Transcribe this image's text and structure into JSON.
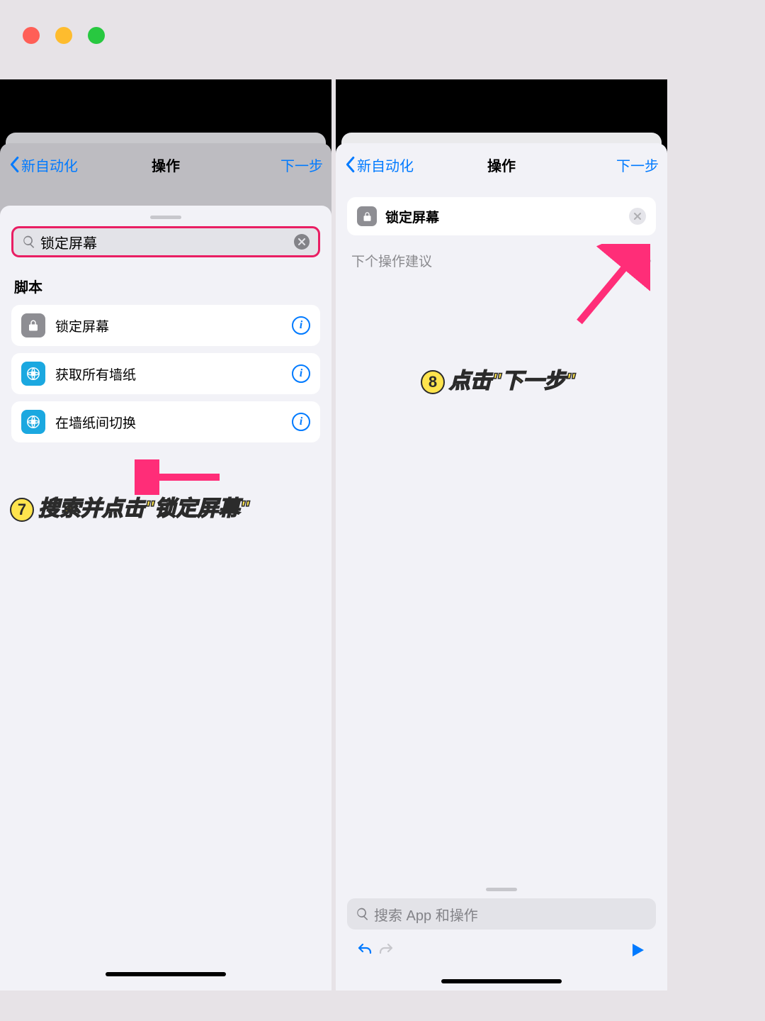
{
  "left": {
    "nav": {
      "back": "新自动化",
      "title": "操作",
      "next": "下一步"
    },
    "search_value": "锁定屏幕",
    "section": "脚本",
    "actions": [
      {
        "label": "锁定屏幕",
        "icon": "lock"
      },
      {
        "label": "获取所有墙纸",
        "icon": "wallpaper"
      },
      {
        "label": "在墙纸间切换",
        "icon": "wallpaper"
      }
    ]
  },
  "right": {
    "nav": {
      "back": "新自动化",
      "title": "操作",
      "next": "下一步"
    },
    "token": "锁定屏幕",
    "suggest": "下个操作建议",
    "search_placeholder": "搜索 App 和操作"
  },
  "annot": {
    "seven_num": "7",
    "seven": "搜索并点击\"锁定屏幕\"",
    "eight_num": "8",
    "eight": "点击\"下一步\""
  }
}
